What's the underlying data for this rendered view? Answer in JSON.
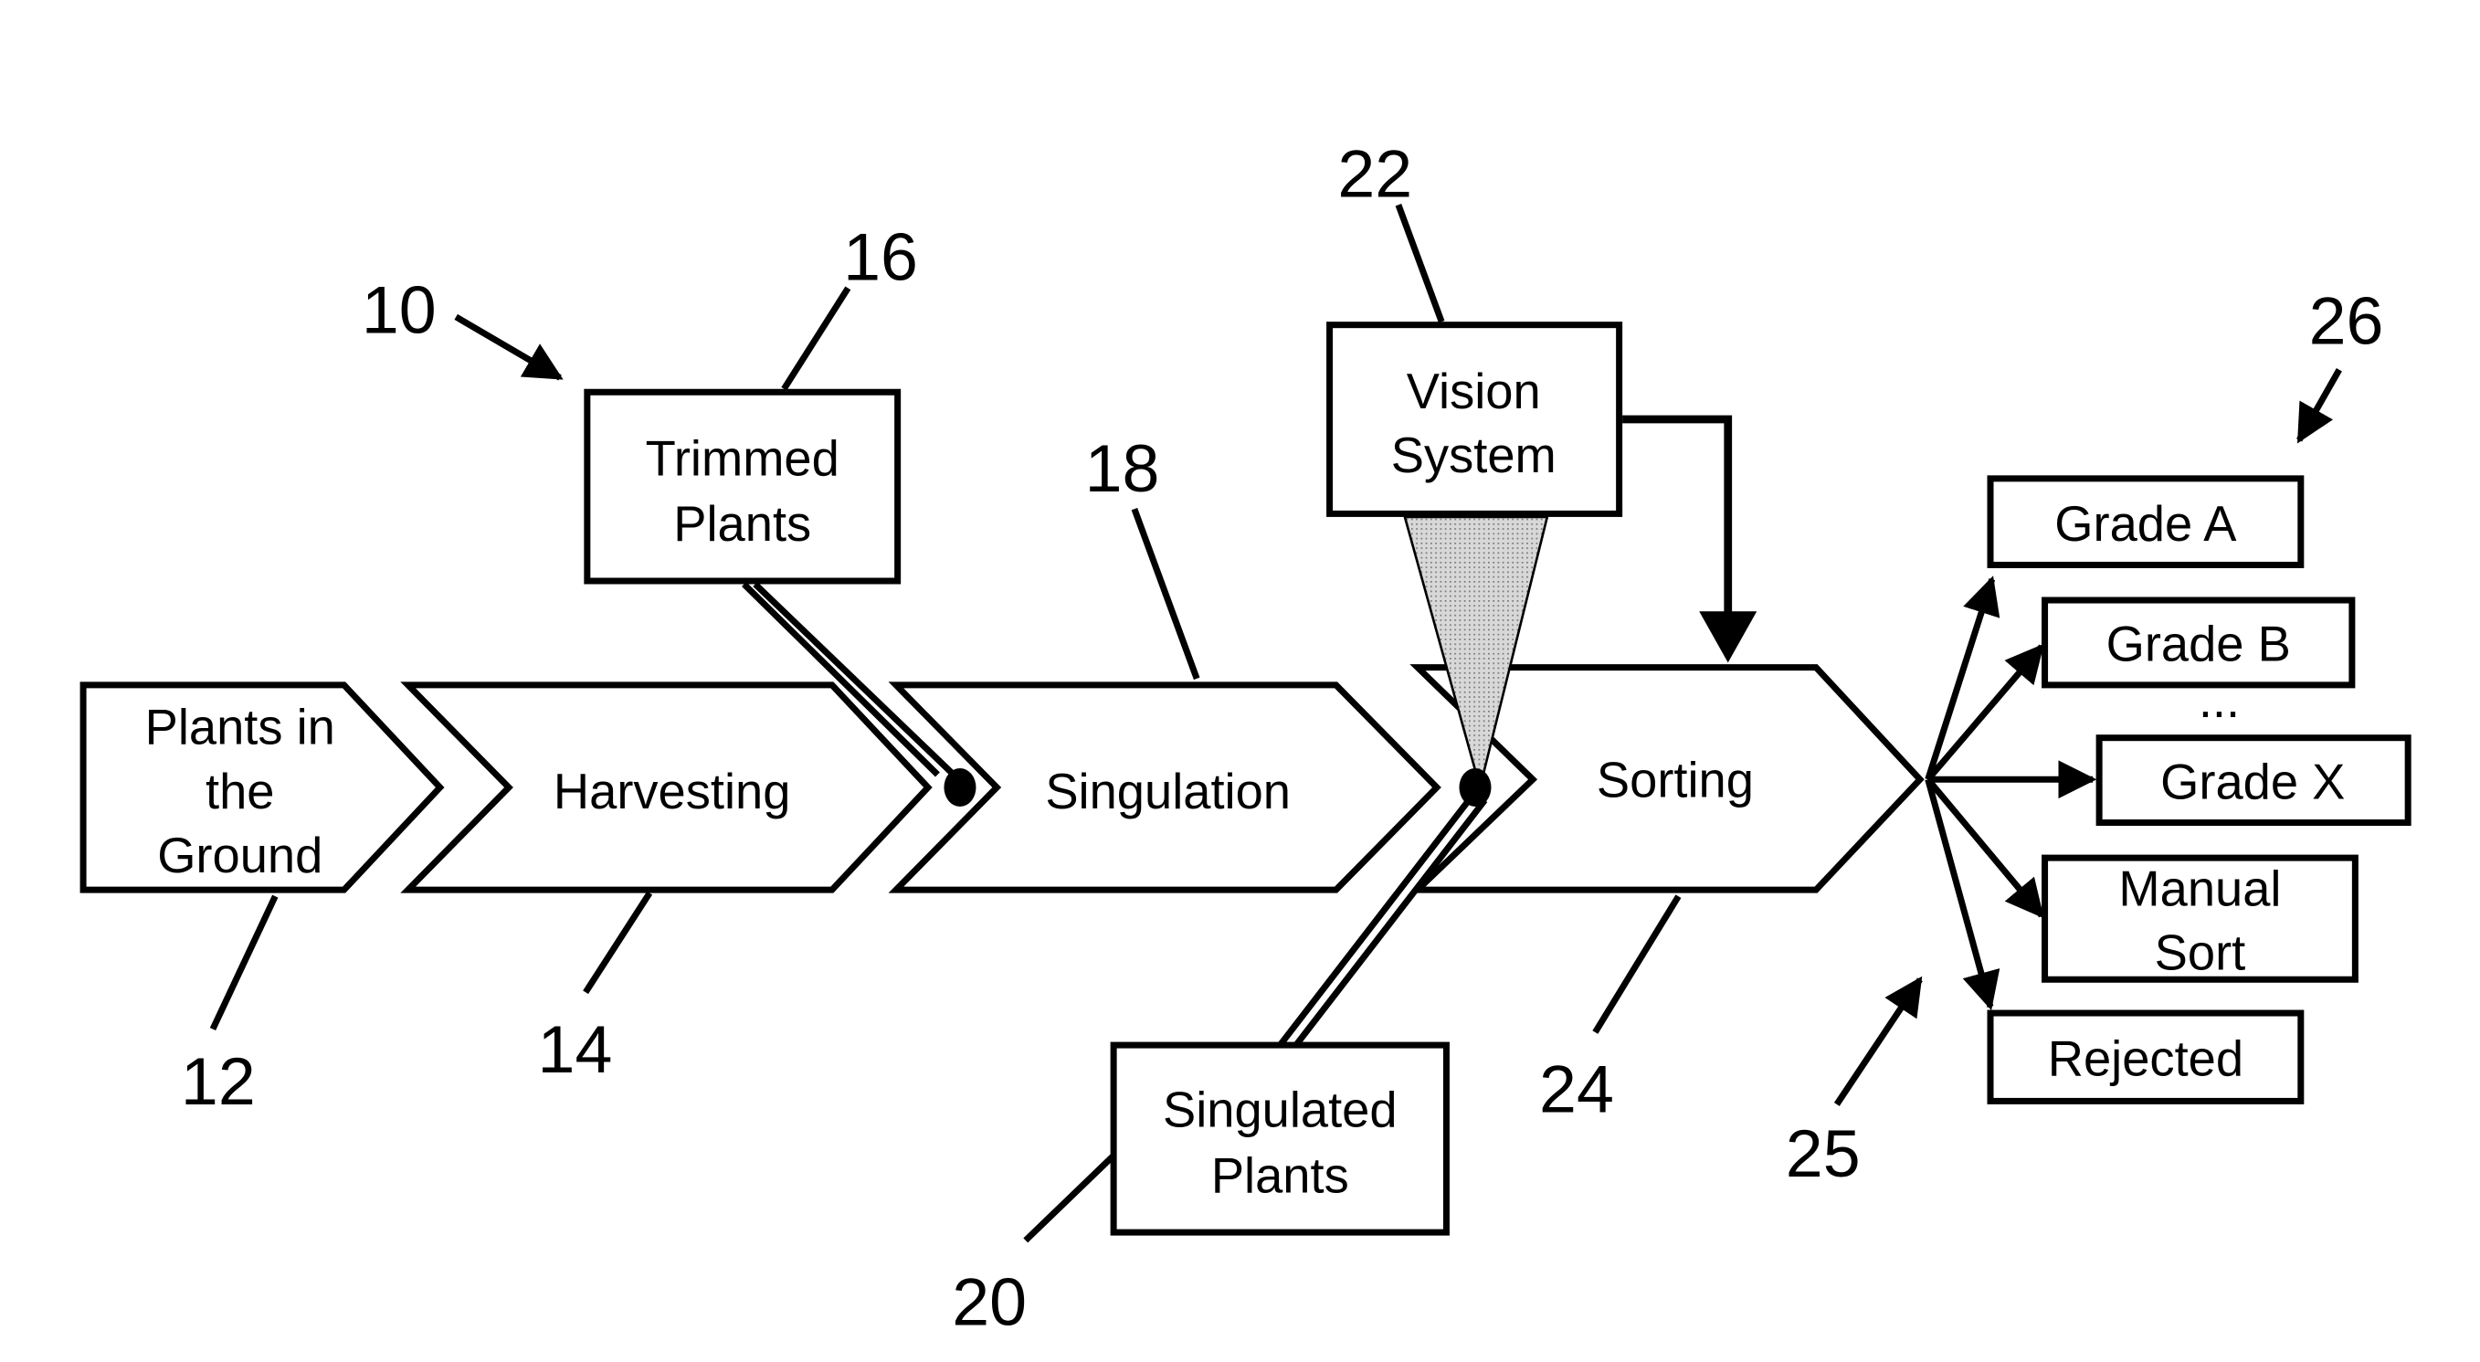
{
  "diagram": {
    "figure_ref": "10",
    "colors": {
      "ink": "#000000",
      "background": "#ffffff",
      "vision_beam": "#bdbdbd"
    },
    "process_steps": [
      {
        "ref": "12",
        "label_lines": [
          "Plants in",
          "the",
          "Ground"
        ]
      },
      {
        "ref": "14",
        "label_lines": [
          "Harvesting"
        ]
      },
      {
        "ref": "18",
        "label_lines": [
          "Singulation"
        ]
      },
      {
        "ref": "24",
        "label_lines": [
          "Sorting"
        ]
      }
    ],
    "boxes": {
      "trimmed": {
        "ref": "16",
        "label_lines": [
          "Trimmed",
          "Plants"
        ]
      },
      "vision": {
        "ref": "22",
        "label_lines": [
          "Vision",
          "System"
        ]
      },
      "singulated": {
        "ref": "20",
        "label_lines": [
          "Singulated",
          "Plants"
        ]
      }
    },
    "sort_outputs": {
      "ref": "26",
      "sorter_ref": "25",
      "ellipsis": "...",
      "items": [
        {
          "label_lines": [
            "Grade A"
          ]
        },
        {
          "label_lines": [
            "Grade B"
          ]
        },
        {
          "label_lines": [
            "Grade X"
          ]
        },
        {
          "label_lines": [
            "Manual",
            "Sort"
          ]
        },
        {
          "label_lines": [
            "Rejected"
          ]
        }
      ]
    }
  }
}
